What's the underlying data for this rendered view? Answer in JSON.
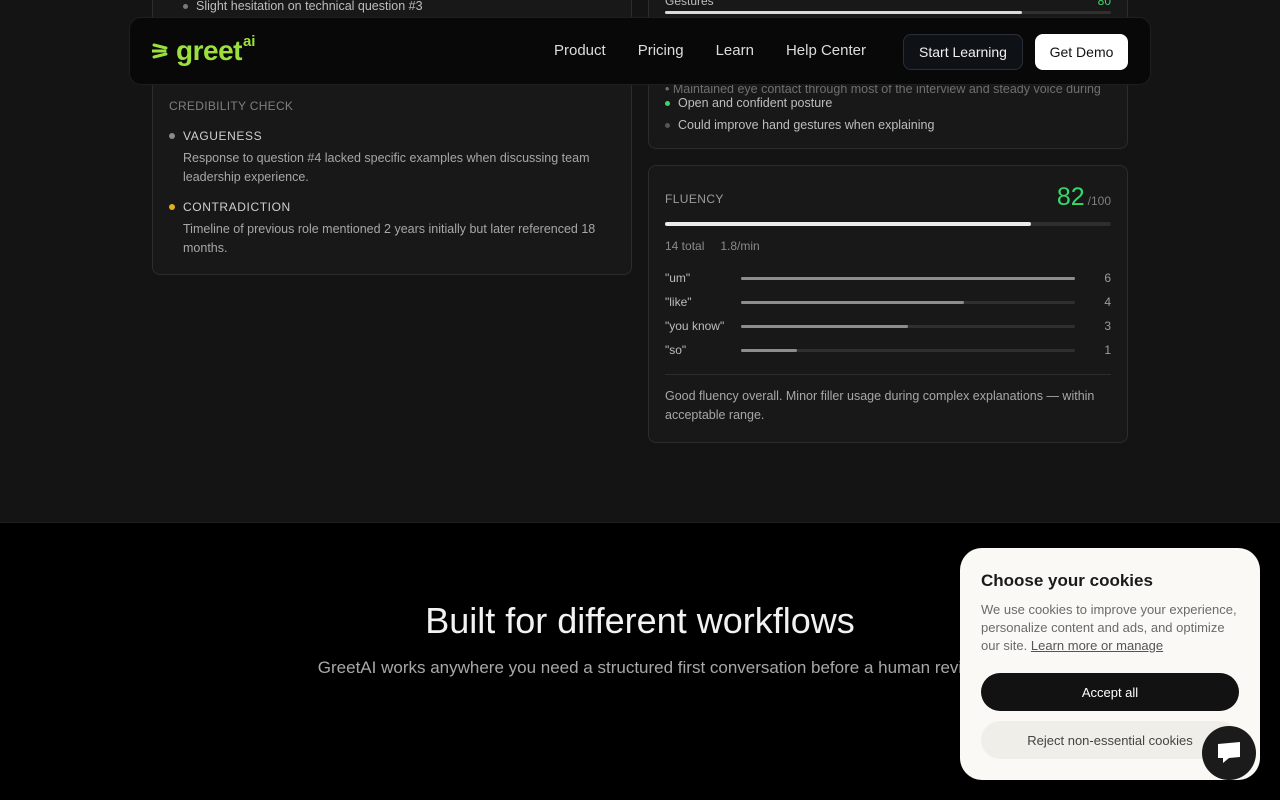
{
  "nav": {
    "logo_text": "greet",
    "logo_suffix": "ai",
    "links": [
      "Product",
      "Pricing",
      "Learn",
      "Help Center"
    ],
    "start_label": "Start Learning",
    "demo_label": "Get Demo"
  },
  "left_card": {
    "hesitation": "Slight hesitation on technical question #3",
    "credibility_title": "CREDIBILITY CHECK",
    "issues": [
      {
        "title": "VAGUENESS",
        "color": "#8a8a8a",
        "body": "Response to question #4 lacked specific examples when discussing team leadership experience."
      },
      {
        "title": "CONTRADICTION",
        "color": "#e0b020",
        "body": "Timeline of previous role mentioned 2 years initially but later referenced 18 months."
      }
    ]
  },
  "body_language": {
    "gestures_label": "Gestures",
    "gestures_value": "80",
    "gestures_fraction": 0.8,
    "observations": [
      {
        "text": "Open and confident posture",
        "color": "#39d66b"
      },
      {
        "text": "Could improve hand gestures when explaining",
        "color": "#555555"
      }
    ]
  },
  "fluency": {
    "label": "FLUENCY",
    "score": "82",
    "denominator": "/100",
    "score_fraction": 0.82,
    "total": "14 total",
    "rate": "1.8/min",
    "fillers": [
      {
        "word": "\"um\"",
        "count": "6",
        "fraction": 1.0
      },
      {
        "word": "\"like\"",
        "count": "4",
        "fraction": 0.667
      },
      {
        "word": "\"you know\"",
        "count": "3",
        "fraction": 0.5
      },
      {
        "word": "\"so\"",
        "count": "1",
        "fraction": 0.167
      }
    ],
    "summary": "Good fluency overall. Minor filler usage during complex explanations — within acceptable range."
  },
  "workflows": {
    "title": "Built for different workflows",
    "subtitle": "GreetAI works anywhere you need a structured first conversation before a human revi"
  },
  "cookies": {
    "title": "Choose your cookies",
    "text": "We use cookies to improve your experience, personalize content and ads, and optimize our site.",
    "link": "Learn more or manage",
    "accept": "Accept all",
    "reject": "Reject non-essential cookies"
  },
  "colors": {
    "accent_green": "#39d66b",
    "logo_green": "#9be03c",
    "warning_yellow": "#e0b020"
  }
}
